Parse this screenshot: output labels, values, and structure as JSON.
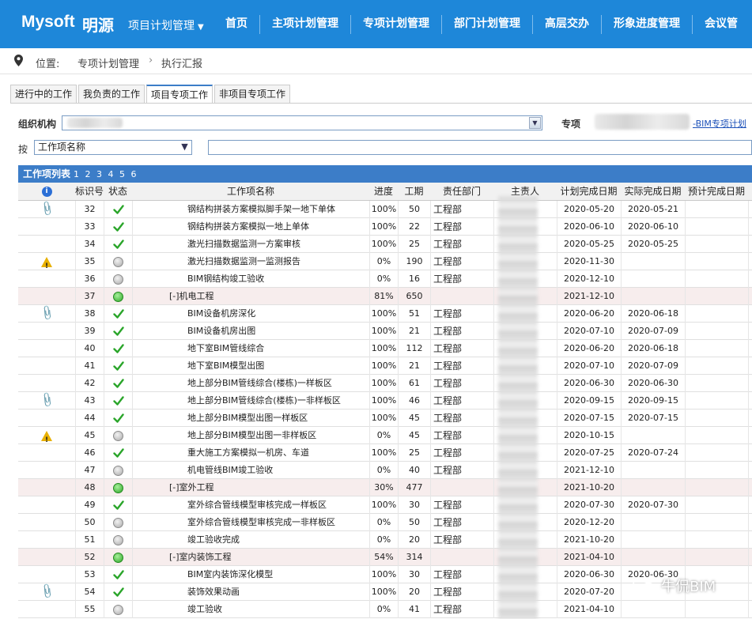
{
  "header": {
    "brand": "Mysoft",
    "brand_cn": "明源",
    "module": "项目计划管理",
    "nav": [
      "首页",
      "主项计划管理",
      "专项计划管理",
      "部门计划管理",
      "高层交办",
      "形象进度管理",
      "会议管"
    ]
  },
  "breadcrumb": {
    "label": "位置:",
    "items": [
      "专项计划管理",
      "执行汇报"
    ]
  },
  "tabs": [
    "进行中的工作",
    "我负责的工作",
    "项目专项工作",
    "非项目专项工作"
  ],
  "filters": {
    "org_label": "组织机构",
    "special_label": "专项",
    "bim_link": "BIM专项计划",
    "by_label": "按",
    "by_select": "工作项名称"
  },
  "list": {
    "title": "工作项列表",
    "pages": "1 2 3 4 5 6",
    "columns": [
      "标识号",
      "状态",
      "工作项名称",
      "进度",
      "工期",
      "责任部门",
      "主责人",
      "计划完成日期",
      "实际完成日期",
      "预计完成日期"
    ],
    "rows": [
      {
        "id": "32",
        "status": "check",
        "flag": "clip",
        "name": "钢结构拼装方案模拟脚手架一地下单体",
        "indent": 2,
        "progress": "100%",
        "duration": "50",
        "dept": "工程部",
        "plan": "2020-05-20",
        "actual": "2020-05-21",
        "group": false
      },
      {
        "id": "33",
        "status": "check",
        "flag": "",
        "name": "钢结构拼装方案模拟一地上单体",
        "indent": 2,
        "progress": "100%",
        "duration": "22",
        "dept": "工程部",
        "plan": "2020-06-10",
        "actual": "2020-06-10",
        "group": false
      },
      {
        "id": "34",
        "status": "check",
        "flag": "",
        "name": "激光扫描数据监测一方案审核",
        "indent": 2,
        "progress": "100%",
        "duration": "25",
        "dept": "工程部",
        "plan": "2020-05-25",
        "actual": "2020-05-25",
        "group": false
      },
      {
        "id": "35",
        "status": "gray",
        "flag": "warn",
        "name": "激光扫描数据监测一监测报告",
        "indent": 2,
        "progress": "0%",
        "duration": "190",
        "dept": "工程部",
        "plan": "2020-11-30",
        "actual": "",
        "group": false
      },
      {
        "id": "36",
        "status": "gray",
        "flag": "",
        "name": "BIM钢结构竣工验收",
        "indent": 2,
        "progress": "0%",
        "duration": "16",
        "dept": "工程部",
        "plan": "2020-12-10",
        "actual": "",
        "group": false
      },
      {
        "id": "37",
        "status": "green",
        "flag": "",
        "name": "[-]机电工程",
        "indent": 1,
        "progress": "81%",
        "duration": "650",
        "dept": "",
        "plan": "2021-12-10",
        "actual": "",
        "group": true
      },
      {
        "id": "38",
        "status": "check",
        "flag": "clip",
        "name": "BIM设备机房深化",
        "indent": 2,
        "progress": "100%",
        "duration": "51",
        "dept": "工程部",
        "plan": "2020-06-20",
        "actual": "2020-06-18",
        "group": false
      },
      {
        "id": "39",
        "status": "check",
        "flag": "",
        "name": "BIM设备机房出图",
        "indent": 2,
        "progress": "100%",
        "duration": "21",
        "dept": "工程部",
        "plan": "2020-07-10",
        "actual": "2020-07-09",
        "group": false
      },
      {
        "id": "40",
        "status": "check",
        "flag": "",
        "name": "地下室BIM管线综合",
        "indent": 2,
        "progress": "100%",
        "duration": "112",
        "dept": "工程部",
        "plan": "2020-06-20",
        "actual": "2020-06-18",
        "group": false
      },
      {
        "id": "41",
        "status": "check",
        "flag": "",
        "name": "地下室BIM模型出图",
        "indent": 2,
        "progress": "100%",
        "duration": "21",
        "dept": "工程部",
        "plan": "2020-07-10",
        "actual": "2020-07-09",
        "group": false
      },
      {
        "id": "42",
        "status": "check",
        "flag": "",
        "name": "地上部分BIM管线综合(楼栋)一样板区",
        "indent": 2,
        "progress": "100%",
        "duration": "61",
        "dept": "工程部",
        "plan": "2020-06-30",
        "actual": "2020-06-30",
        "group": false
      },
      {
        "id": "43",
        "status": "check",
        "flag": "clip",
        "name": "地上部分BIM管线综合(楼栋)一非样板区",
        "indent": 2,
        "progress": "100%",
        "duration": "46",
        "dept": "工程部",
        "plan": "2020-09-15",
        "actual": "2020-09-15",
        "group": false
      },
      {
        "id": "44",
        "status": "check",
        "flag": "",
        "name": "地上部分BIM模型出图一样板区",
        "indent": 2,
        "progress": "100%",
        "duration": "45",
        "dept": "工程部",
        "plan": "2020-07-15",
        "actual": "2020-07-15",
        "group": false
      },
      {
        "id": "45",
        "status": "gray",
        "flag": "warn",
        "name": "地上部分BIM模型出图一非样板区",
        "indent": 2,
        "progress": "0%",
        "duration": "45",
        "dept": "工程部",
        "plan": "2020-10-15",
        "actual": "",
        "group": false
      },
      {
        "id": "46",
        "status": "check",
        "flag": "",
        "name": "重大施工方案模拟一机房、车道",
        "indent": 2,
        "progress": "100%",
        "duration": "25",
        "dept": "工程部",
        "plan": "2020-07-25",
        "actual": "2020-07-24",
        "group": false
      },
      {
        "id": "47",
        "status": "gray",
        "flag": "",
        "name": "机电管线BIM竣工验收",
        "indent": 2,
        "progress": "0%",
        "duration": "40",
        "dept": "工程部",
        "plan": "2021-12-10",
        "actual": "",
        "group": false
      },
      {
        "id": "48",
        "status": "green",
        "flag": "",
        "name": "[-]室外工程",
        "indent": 1,
        "progress": "30%",
        "duration": "477",
        "dept": "",
        "plan": "2021-10-20",
        "actual": "",
        "group": true
      },
      {
        "id": "49",
        "status": "check",
        "flag": "",
        "name": "室外综合管线模型审核完成一样板区",
        "indent": 2,
        "progress": "100%",
        "duration": "30",
        "dept": "工程部",
        "plan": "2020-07-30",
        "actual": "2020-07-30",
        "group": false
      },
      {
        "id": "50",
        "status": "gray",
        "flag": "",
        "name": "室外综合管线模型审核完成一非样板区",
        "indent": 2,
        "progress": "0%",
        "duration": "50",
        "dept": "工程部",
        "plan": "2020-12-20",
        "actual": "",
        "group": false
      },
      {
        "id": "51",
        "status": "gray",
        "flag": "",
        "name": "竣工验收完成",
        "indent": 2,
        "progress": "0%",
        "duration": "20",
        "dept": "工程部",
        "plan": "2021-10-20",
        "actual": "",
        "group": false
      },
      {
        "id": "52",
        "status": "green",
        "flag": "",
        "name": "[-]室内装饰工程",
        "indent": 1,
        "progress": "54%",
        "duration": "314",
        "dept": "",
        "plan": "2021-04-10",
        "actual": "",
        "group": true
      },
      {
        "id": "53",
        "status": "check",
        "flag": "",
        "name": "BIM室内装饰深化模型",
        "indent": 2,
        "progress": "100%",
        "duration": "30",
        "dept": "工程部",
        "plan": "2020-06-30",
        "actual": "2020-06-30",
        "group": false
      },
      {
        "id": "54",
        "status": "check",
        "flag": "clip",
        "name": "装饰效果动画",
        "indent": 2,
        "progress": "100%",
        "duration": "20",
        "dept": "工程部",
        "plan": "2020-07-20",
        "actual": "",
        "group": false
      },
      {
        "id": "55",
        "status": "gray",
        "flag": "",
        "name": "竣工验收",
        "indent": 2,
        "progress": "0%",
        "duration": "41",
        "dept": "工程部",
        "plan": "2021-04-10",
        "actual": "",
        "group": false
      }
    ]
  },
  "watermark": "牛侃BIM"
}
